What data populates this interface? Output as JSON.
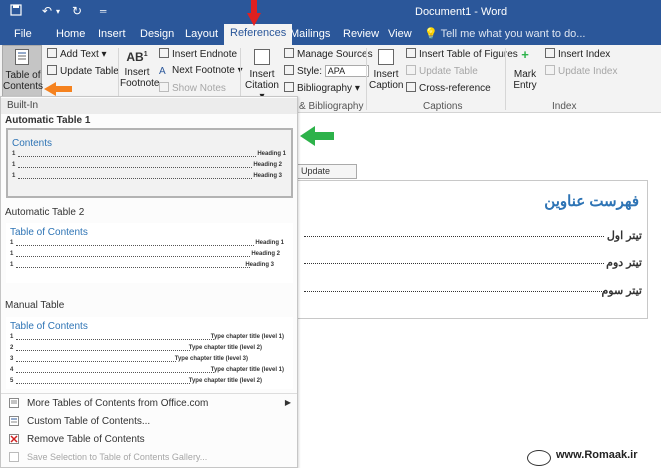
{
  "window": {
    "title": "Document1 - Word"
  },
  "tabs": [
    "File",
    "Home",
    "Insert",
    "Design",
    "Layout",
    "References",
    "Mailings",
    "Review",
    "View"
  ],
  "tell_me": "Tell me what you want to do...",
  "ribbon": {
    "toc": {
      "big_button": "Table of Contents",
      "add_text": "Add Text",
      "update_table": "Update Table"
    },
    "footnotes": {
      "insert_footnote": "Insert Footnote",
      "insert_endnote": "Insert Endnote",
      "next_footnote": "Next Footnote",
      "show_notes": "Show Notes"
    },
    "citations": {
      "insert_citation": "Insert Citation",
      "manage_sources": "Manage Sources",
      "style_label": "Style:",
      "style_value": "APA",
      "bibliography": "Bibliography",
      "group_label": "& Bibliography"
    },
    "captions": {
      "insert_caption": "Insert Caption",
      "insert_table_of_figures": "Insert Table of Figures",
      "update_table": "Update Table",
      "cross_reference": "Cross-reference",
      "group_label": "Captions"
    },
    "index": {
      "mark_entry": "Mark Entry",
      "insert_index": "Insert Index",
      "update_index": "Update Index",
      "group_label": "Index"
    }
  },
  "dropdown": {
    "built_in": "Built-In",
    "auto1": {
      "header": "Automatic Table 1",
      "title": "Contents",
      "rows": [
        {
          "num": "1",
          "label": "Heading 1"
        },
        {
          "num": "1",
          "label": "Heading 2"
        },
        {
          "num": "1",
          "label": "Heading 3"
        }
      ]
    },
    "auto2": {
      "header": "Automatic Table 2",
      "title": "Table of Contents",
      "rows": [
        {
          "num": "1",
          "label": "Heading 1"
        },
        {
          "num": "1",
          "label": "Heading 2"
        },
        {
          "num": "1",
          "label": "Heading 3"
        }
      ]
    },
    "manual": {
      "header": "Manual Table",
      "title": "Table of Contents",
      "rows": [
        {
          "num": "1",
          "label": "Type chapter title (level 1)"
        },
        {
          "num": "2",
          "label": "Type chapter title (level 2)"
        },
        {
          "num": "3",
          "label": "Type chapter title (level 3)"
        },
        {
          "num": "4",
          "label": "Type chapter title (level 1)"
        },
        {
          "num": "5",
          "label": "Type chapter title (level 2)"
        }
      ]
    },
    "menu": {
      "more": "More Tables of Contents from Office.com",
      "custom": "Custom Table of Contents...",
      "remove": "Remove Table of Contents",
      "save": "Save Selection to Table of Contents Gallery..."
    }
  },
  "document": {
    "update_table_tab": "Update Table...",
    "toc_title": "فهرست عناوین",
    "entries": [
      "تیتر اول",
      "تیتر دوم",
      "تیتر سوم"
    ]
  },
  "watermark": "www.Romaak.ir",
  "colors": {
    "word_blue": "#2b579a",
    "heading_blue": "#2e74b5",
    "red_arrow": "#e02020",
    "orange_arrow": "#f5821f",
    "green_arrow": "#2db24a"
  }
}
